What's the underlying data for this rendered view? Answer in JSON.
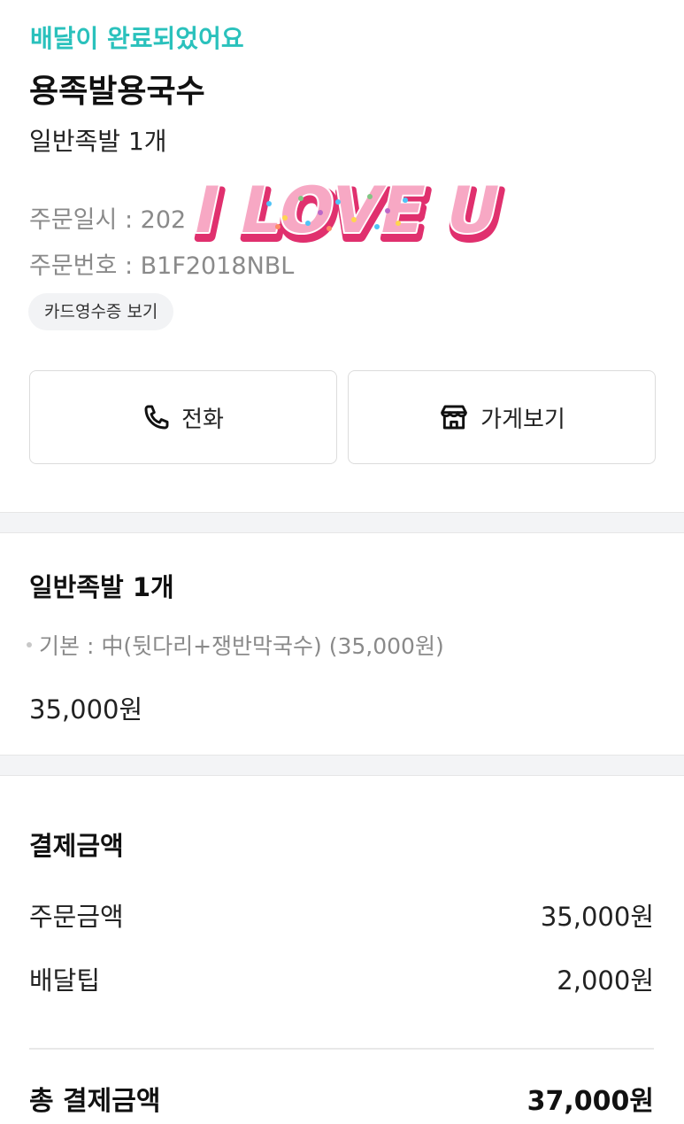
{
  "header": {
    "status": "배달이 완료되었어요",
    "store_name": "용족발용국수",
    "order_summary": "일반족발 1개"
  },
  "order_meta": {
    "date_label": "주문일시 :",
    "date_value_prefix": "202",
    "date_value_suffix": "4",
    "number_label": "주문번호 :",
    "number_value": "B1F2018NBL"
  },
  "receipt_button": "카드영수증 보기",
  "actions": {
    "call_label": "전화",
    "store_label": "가게보기"
  },
  "item": {
    "title": "일반족발 1개",
    "option": "기본 : 中(뒷다리+쟁반막국수) (35,000원)",
    "price": "35,000원"
  },
  "payment": {
    "title": "결제금액",
    "order_amount_label": "주문금액",
    "order_amount_value": "35,000원",
    "delivery_tip_label": "배달팁",
    "delivery_tip_value": "2,000원",
    "total_label": "총 결제금액",
    "total_value": "37,000원"
  },
  "sticker": {
    "text": "I LOVE U"
  },
  "colors": {
    "accent": "#2ac1bc",
    "sticker_fill": "#f7a8c4",
    "sticker_shadow": "#e0306e"
  }
}
